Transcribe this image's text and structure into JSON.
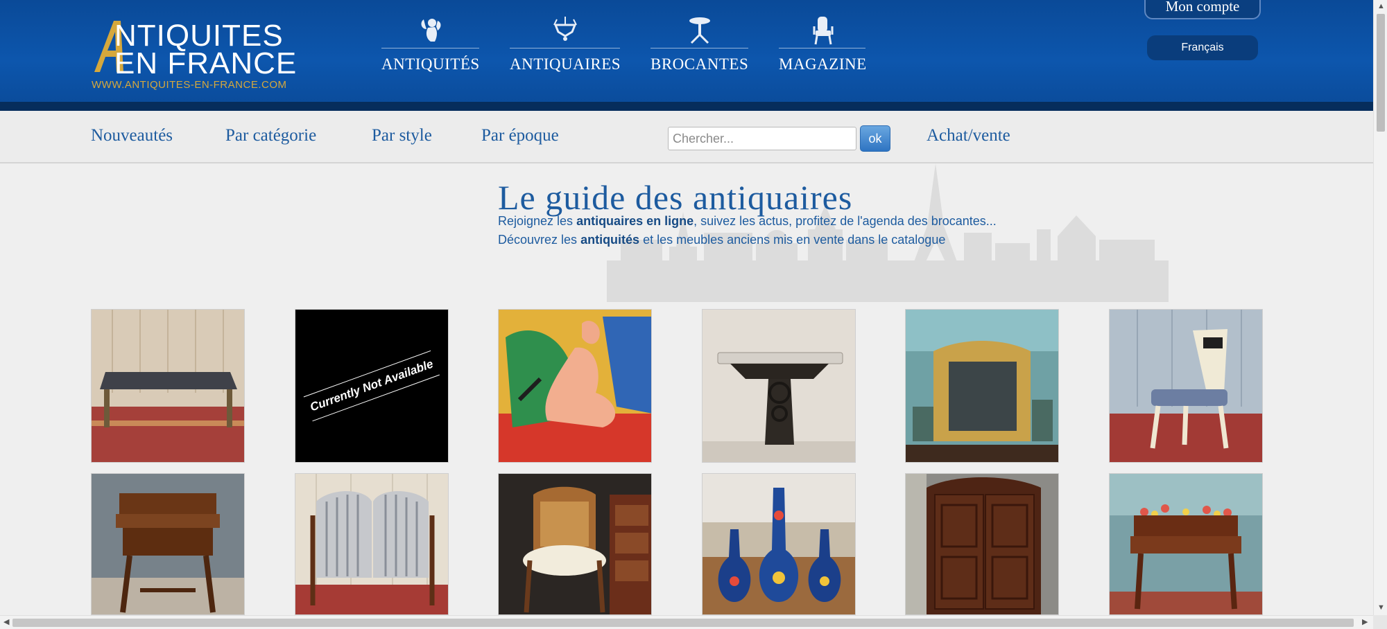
{
  "colors": {
    "header_blue": "#0d56ad",
    "header_strip": "#062d5c",
    "link_blue": "#1d5b9f",
    "logo_gold": "#d6a83c"
  },
  "header": {
    "logo": {
      "line1": "NTIQUITES",
      "line2": "EN FRANCE",
      "url": "WWW.ANTIQUITES-EN-FRANCE.COM"
    },
    "nav": [
      {
        "label": "ANTIQUITÉS",
        "icon": "cherub-icon"
      },
      {
        "label": "ANTIQUAIRES",
        "icon": "chandelier-icon"
      },
      {
        "label": "BROCANTES",
        "icon": "pedestal-table-icon"
      },
      {
        "label": "MAGAZINE",
        "icon": "armchair-icon"
      }
    ],
    "account_label": "Mon compte",
    "language_label": "Français"
  },
  "subnav": {
    "links": [
      "Nouveautés",
      "Par catégorie",
      "Par style",
      "Par époque"
    ],
    "search_placeholder": "Chercher...",
    "search_button": "ok",
    "buy_sell": "Achat/vente"
  },
  "hero": {
    "title": "Le guide des antiquaires",
    "line1_pre": "Rejoignez les ",
    "line1_bold": "antiquaires en ligne",
    "line1_post": ", suivez les actus, profitez de l'agenda des brocantes...",
    "line2_pre": "Découvrez les ",
    "line2_bold": "antiquités",
    "line2_post": " et les meubles anciens mis en vente dans le catalogue"
  },
  "products": [
    {
      "name": "coffee-table-photo"
    },
    {
      "name": "unavailable-photo",
      "overlay": "Currently Not Available"
    },
    {
      "name": "nude-painting-photo"
    },
    {
      "name": "console-table-photo"
    },
    {
      "name": "gilt-mirror-photo"
    },
    {
      "name": "chair-photo"
    },
    {
      "name": "work-table-photo"
    },
    {
      "name": "corner-armchairs-photo"
    },
    {
      "name": "cane-armchair-photo"
    },
    {
      "name": "vases-photo"
    },
    {
      "name": "armoire-photo"
    },
    {
      "name": "planter-table-photo"
    }
  ]
}
